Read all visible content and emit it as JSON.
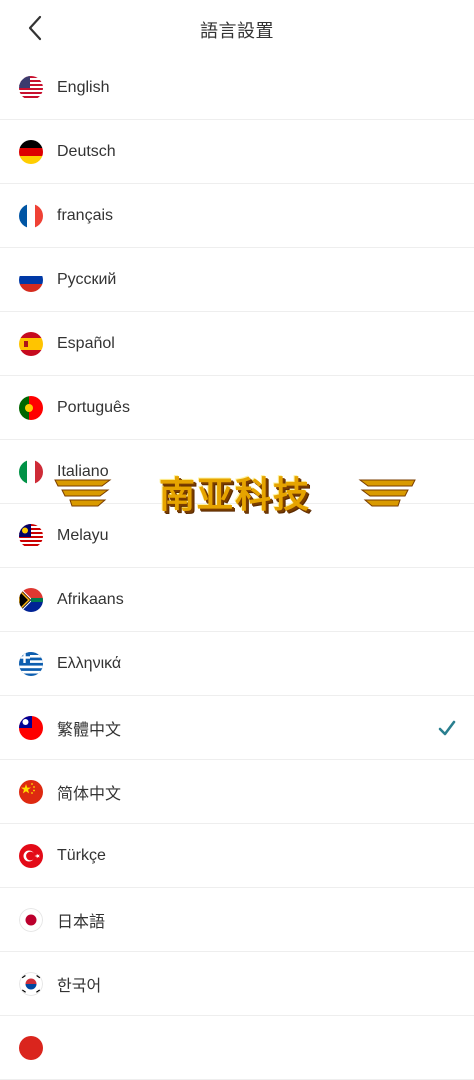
{
  "header": {
    "title": "語言設置"
  },
  "languages": [
    {
      "label": "English",
      "flag": "us-flag-icon",
      "selected": false
    },
    {
      "label": "Deutsch",
      "flag": "de-flag-icon",
      "selected": false
    },
    {
      "label": "français",
      "flag": "fr-flag-icon",
      "selected": false
    },
    {
      "label": "Русский",
      "flag": "ru-flag-icon",
      "selected": false
    },
    {
      "label": "Español",
      "flag": "es-flag-icon",
      "selected": false
    },
    {
      "label": "Português",
      "flag": "pt-flag-icon",
      "selected": false
    },
    {
      "label": "Italiano",
      "flag": "it-flag-icon",
      "selected": false
    },
    {
      "label": "Melayu",
      "flag": "my-flag-icon",
      "selected": false
    },
    {
      "label": "Afrikaans",
      "flag": "za-flag-icon",
      "selected": false
    },
    {
      "label": "Ελληνικά",
      "flag": "gr-flag-icon",
      "selected": false
    },
    {
      "label": "繁體中文",
      "flag": "tw-flag-icon",
      "selected": true
    },
    {
      "label": "简体中文",
      "flag": "cn-flag-icon",
      "selected": false
    },
    {
      "label": "Türkçe",
      "flag": "tr-flag-icon",
      "selected": false
    },
    {
      "label": "日本語",
      "flag": "jp-flag-icon",
      "selected": false
    },
    {
      "label": "한국어",
      "flag": "kr-flag-icon",
      "selected": false
    }
  ],
  "watermark": {
    "text": "南亚科技"
  },
  "colors": {
    "check": "#2a7f8f",
    "divider": "#eeeeee",
    "text": "#333333"
  }
}
